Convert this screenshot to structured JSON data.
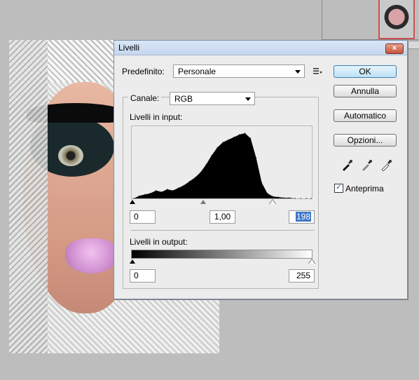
{
  "dialog": {
    "title": "Livelli",
    "close_label": "×",
    "preset": {
      "label": "Predefinito:",
      "value": "Personale"
    },
    "channel": {
      "label": "Canale:",
      "value": "RGB"
    },
    "input_levels": {
      "label": "Livelli in input:",
      "black": "0",
      "gamma": "1,00",
      "white": "198"
    },
    "output_levels": {
      "label": "Livelli in output:",
      "black": "0",
      "white": "255"
    },
    "buttons": {
      "ok": "OK",
      "cancel": "Annulla",
      "auto": "Automatico",
      "options": "Opzioni..."
    },
    "preview": {
      "label": "Anteprima",
      "checked": true,
      "check_glyph": "✓"
    },
    "icons": [
      "preset-menu-icon",
      "black-eyedropper-icon",
      "gray-eyedropper-icon",
      "white-eyedropper-icon"
    ]
  },
  "chart_data": {
    "type": "area",
    "xlim": [
      0,
      255
    ],
    "x": [
      0,
      8,
      16,
      24,
      32,
      40,
      48,
      56,
      64,
      72,
      80,
      88,
      96,
      104,
      112,
      120,
      128,
      136,
      144,
      152,
      160,
      168,
      176,
      184,
      192,
      200,
      208,
      216,
      224,
      232,
      240,
      248,
      255
    ],
    "values": [
      0,
      4,
      6,
      8,
      12,
      10,
      14,
      12,
      16,
      20,
      26,
      32,
      40,
      52,
      66,
      78,
      86,
      90,
      94,
      98,
      100,
      92,
      62,
      24,
      8,
      3,
      2,
      1,
      1,
      0,
      0,
      0,
      0
    ]
  },
  "colors": {
    "title_bar": "#c4d6ee",
    "close_button": "#c2543c",
    "selection": "#3a76c8",
    "thumb_border": "#d05050"
  }
}
